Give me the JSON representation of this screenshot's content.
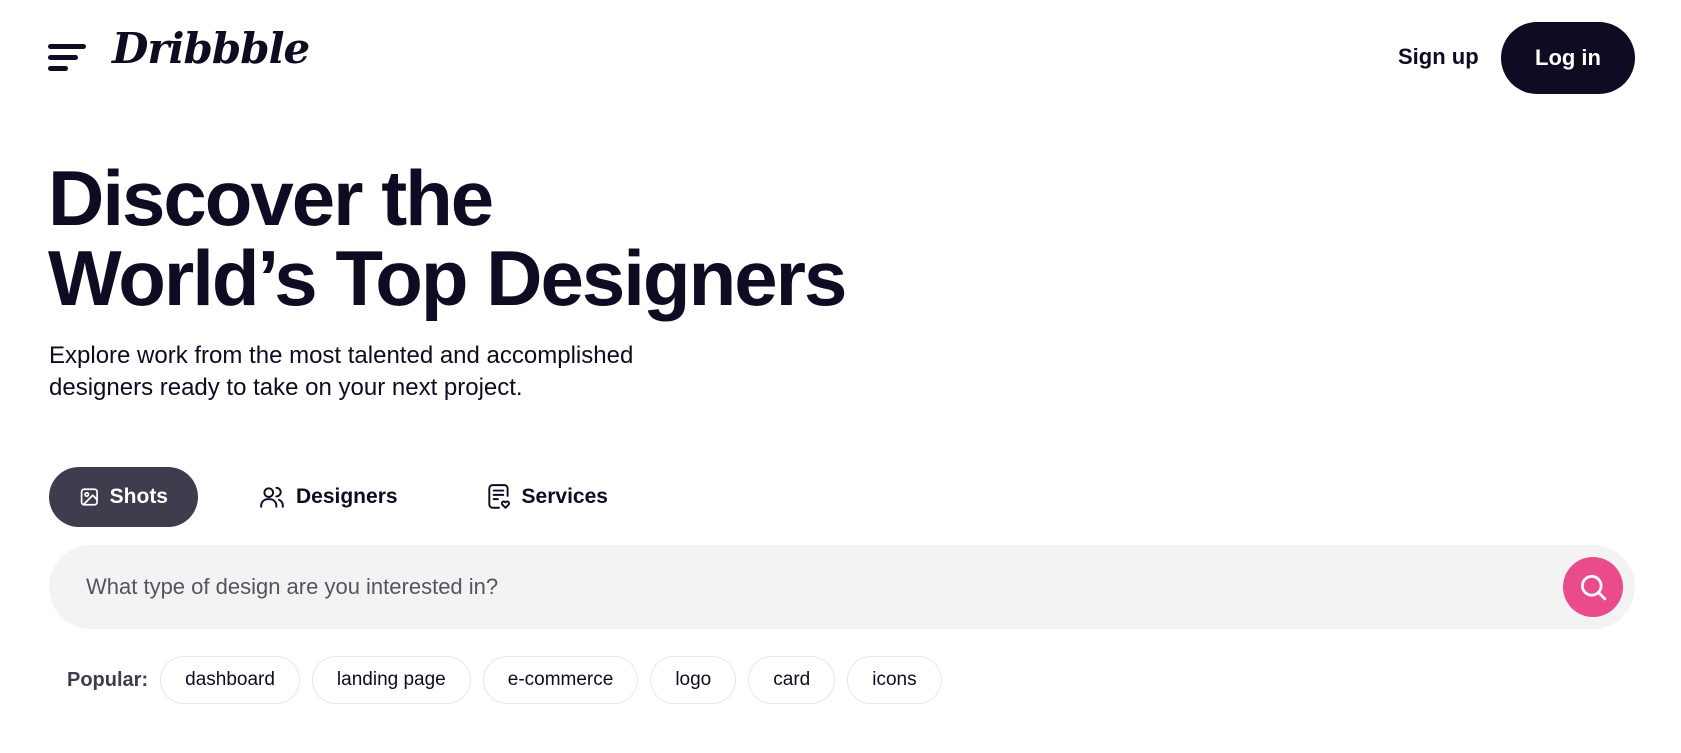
{
  "header": {
    "logo": "Dribbble",
    "signup_label": "Sign up",
    "login_label": "Log in"
  },
  "hero": {
    "title_line1": "Discover the",
    "title_line2": "World’s Top Designers",
    "subtitle_line1": "Explore work from the most talented and accomplished",
    "subtitle_line2": "designers ready to take on your next project."
  },
  "tabs": [
    {
      "label": "Shots",
      "icon": "image-icon",
      "active": true
    },
    {
      "label": "Designers",
      "icon": "users-icon",
      "active": false
    },
    {
      "label": "Services",
      "icon": "document-heart-icon",
      "active": false
    }
  ],
  "search": {
    "placeholder": "What type of design are you interested in?",
    "value": "",
    "icon": "search-icon"
  },
  "popular": {
    "label": "Popular:",
    "tags": [
      "dashboard",
      "landing page",
      "e-commerce",
      "logo",
      "card",
      "icons"
    ]
  },
  "colors": {
    "brand_dark": "#0d0c22",
    "tab_active": "#3d3d4e",
    "search_bg": "#f3f3f4",
    "accent_pink": "#ea4c89"
  }
}
